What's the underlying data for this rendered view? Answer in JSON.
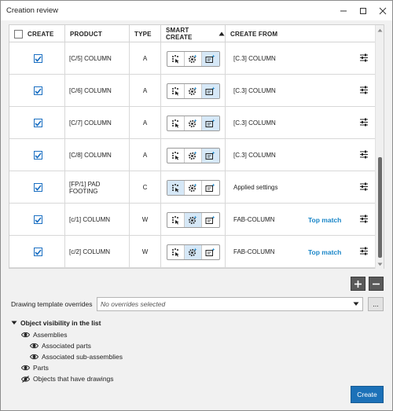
{
  "window": {
    "title": "Creation review"
  },
  "table": {
    "headers": {
      "create": "CREATE",
      "product": "PRODUCT",
      "type": "TYPE",
      "smart_create": "SMART CREATE",
      "create_from": "CREATE FROM"
    },
    "rows": [
      {
        "product": "[C/5] COLUMN",
        "type": "A",
        "create_from": "[C.3] COLUMN",
        "smart_selected": "template",
        "top_match": ""
      },
      {
        "product": "[C/6] COLUMN",
        "type": "A",
        "create_from": "[C.3] COLUMN",
        "smart_selected": "template",
        "top_match": ""
      },
      {
        "product": "[C/7] COLUMN",
        "type": "A",
        "create_from": "[C.3] COLUMN",
        "smart_selected": "template",
        "top_match": ""
      },
      {
        "product": "[C/8] COLUMN",
        "type": "A",
        "create_from": "[C.3] COLUMN",
        "smart_selected": "template",
        "top_match": ""
      },
      {
        "product": "[FP/1] PAD FOOTING",
        "type": "C",
        "create_from": "Applied settings",
        "smart_selected": "settings",
        "top_match": ""
      },
      {
        "product": "[c/1] COLUMN",
        "type": "W",
        "create_from": "FAB-COLUMN",
        "smart_selected": "gear",
        "top_match": "Top match"
      },
      {
        "product": "[c/2] COLUMN",
        "type": "W",
        "create_from": "FAB-COLUMN",
        "smart_selected": "gear",
        "top_match": "Top match"
      }
    ]
  },
  "drawing_template": {
    "label": "Drawing template overrides",
    "value": "No overrides selected",
    "browse_label": "..."
  },
  "visibility": {
    "heading": "Object visibility in the list",
    "items": {
      "assemblies": "Assemblies",
      "associated_parts": "Associated parts",
      "associated_sub_assemblies": "Associated sub-assemblies",
      "parts": "Parts",
      "objects_with_drawings": "Objects that have drawings"
    }
  },
  "buttons": {
    "create": "Create"
  },
  "colors": {
    "accent": "#1c71b8",
    "top_match": "#1a86c8",
    "selected_segment": "#d6e8f7"
  }
}
